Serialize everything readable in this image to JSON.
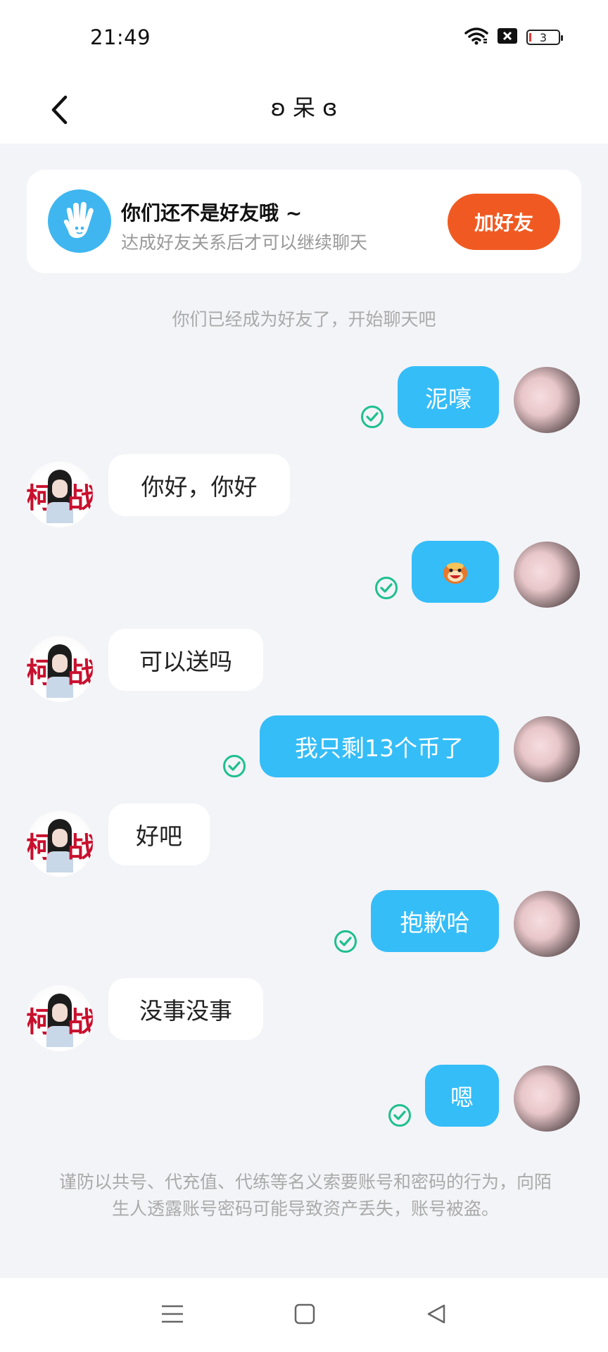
{
  "status_bar": {
    "time": "21:49",
    "battery_level": "3",
    "icons": [
      "wifi-icon",
      "sim-blocked-icon",
      "battery-icon"
    ]
  },
  "header": {
    "title": "ʚ 呆 ɞ",
    "back_icon": "chevron-left-icon"
  },
  "friend_card": {
    "title": "你们还不是好友哦 ~",
    "subtitle": "达成好友关系后才可以继续聊天",
    "button_label": "加好友",
    "icon": "hand-wave-icon",
    "button_color": "#f05a22",
    "icon_bg": "#3fb6ef"
  },
  "system_note": "你们已经成为好友了，开始聊天吧",
  "messages": [
    {
      "from": "me",
      "text": "泥嚎",
      "sent": true
    },
    {
      "from": "other",
      "text": "你好，你好"
    },
    {
      "from": "me",
      "text": "",
      "emoji": "monkey-emoji",
      "sent": true
    },
    {
      "from": "other",
      "text": "可以送吗"
    },
    {
      "from": "me",
      "text": "我只剩13个币了",
      "sent": true
    },
    {
      "from": "other",
      "text": "好吧"
    },
    {
      "from": "me",
      "text": "抱歉哈",
      "sent": true
    },
    {
      "from": "other",
      "text": "没事没事"
    },
    {
      "from": "me",
      "text": "嗯",
      "sent": true
    }
  ],
  "avatar_other_text": "柯 战",
  "footer_warning": "谨防以共号、代充值、代练等名义索要账号和密码的行为，向陌生人透露账号密码可能导致资产丢失，账号被盗。",
  "colors": {
    "my_bubble": "#35bdf8",
    "other_bubble": "#ffffff",
    "check": "#1fbf8f",
    "background": "#f3f4f8"
  },
  "bottom_nav": [
    "menu-icon",
    "home-square-icon",
    "back-triangle-icon"
  ]
}
